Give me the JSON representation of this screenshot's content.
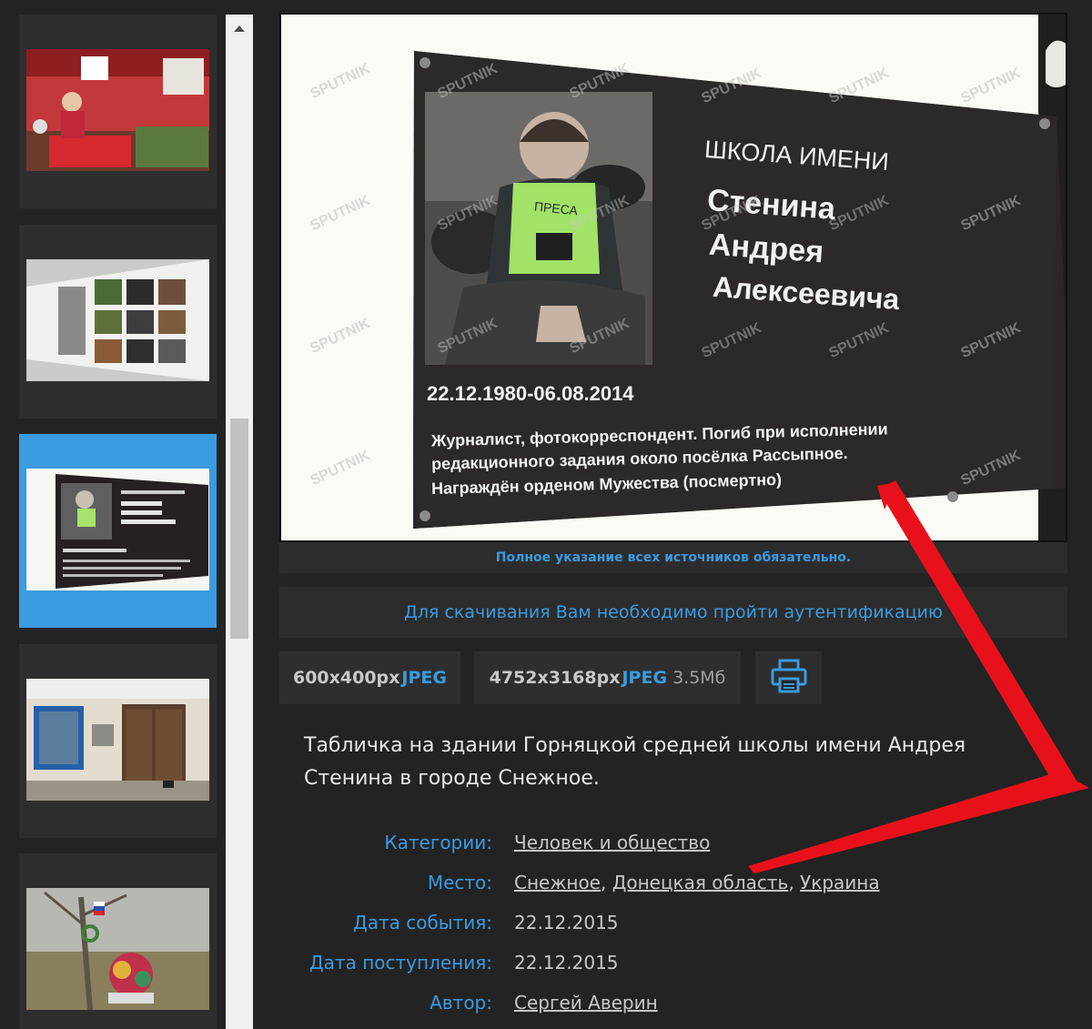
{
  "thumbnails": [
    {
      "label": "thumbnail-1"
    },
    {
      "label": "thumbnail-2"
    },
    {
      "label": "thumbnail-3"
    },
    {
      "label": "thumbnail-4"
    },
    {
      "label": "thumbnail-5"
    }
  ],
  "photo": {
    "watermark": "SPUTNIK",
    "plaque": {
      "title": "ШКОЛА ИМЕНИ",
      "name1": "Стенина",
      "name2": "Андрея",
      "name3": "Алексеевича",
      "dates": "22.12.1980-06.08.2014",
      "bio1": "Журналист, фотокорреспондент. Погиб при исполнении",
      "bio2": "редакционного задания около посёлка Рассыпное.",
      "bio3": "Награждён орденом Мужества (посмертно)",
      "vest_text": "ПРЕСА"
    }
  },
  "credit_notice": "Полное указание всех источников обязательно.",
  "auth_notice": "Для скачивания Вам необходимо пройти аутентификацию",
  "downloads": [
    {
      "resolution": "600x400px",
      "format": "JPEG",
      "size": ""
    },
    {
      "resolution": "4752x3168px",
      "format": "JPEG",
      "size": "3.5Мб"
    }
  ],
  "print_icon": "printer-icon",
  "caption": "Табличка на здании Горняцкой средней школы имени Андрея Стенина в городе Снежное.",
  "meta": {
    "category_label": "Категории:",
    "category_value": "Человек и общество",
    "place_label": "Место:",
    "place_1": "Снежное",
    "place_2": "Донецкая область",
    "place_3": "Украина",
    "event_date_label": "Дата события:",
    "event_date_value": "22.12.2015",
    "received_label": "Дата поступления:",
    "received_value": "22.12.2015",
    "author_label": "Автор:",
    "author_value": "Сергей Аверин"
  },
  "colors": {
    "accent": "#3a9be0",
    "background": "#232323",
    "annotation": "#e8111b"
  }
}
